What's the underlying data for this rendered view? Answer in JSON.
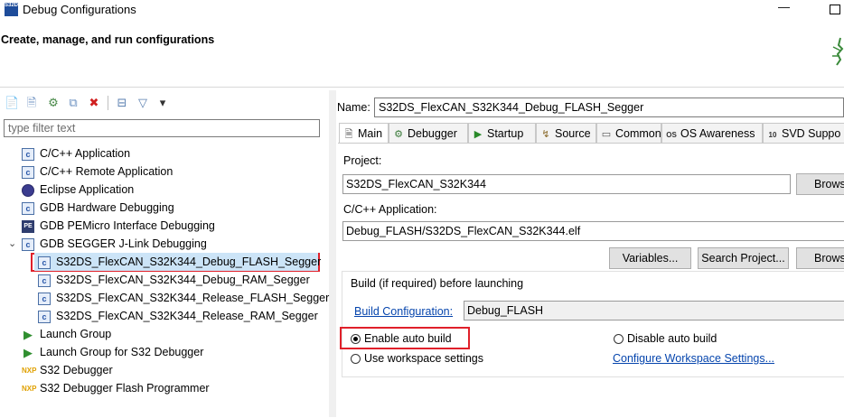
{
  "window": {
    "title": "Debug Configurations",
    "app_icon_text": "S32DS",
    "minimize_glyph": "—"
  },
  "header": {
    "title": "Create, manage, and run configurations"
  },
  "left": {
    "toolbar": [
      {
        "name": "new-configuration-icon",
        "glyph": "📄"
      },
      {
        "name": "new-prototype-icon",
        "glyph": "🗎"
      },
      {
        "name": "export-icon",
        "glyph": "⚙"
      },
      {
        "name": "duplicate-icon",
        "glyph": "⧉"
      },
      {
        "name": "delete-icon",
        "glyph": "✖"
      },
      {
        "name": "collapse-all-icon",
        "glyph": "⊟"
      },
      {
        "name": "filter-icon",
        "glyph": "▽"
      },
      {
        "name": "view-menu-icon",
        "glyph": "▾"
      }
    ],
    "filter_placeholder": "type filter text",
    "tree": [
      {
        "label": "C/C++ Application",
        "icon": "c",
        "indent": 0
      },
      {
        "label": "C/C++ Remote Application",
        "icon": "c",
        "indent": 0
      },
      {
        "label": "Eclipse Application",
        "icon": "eclipse",
        "indent": 0
      },
      {
        "label": "GDB Hardware Debugging",
        "icon": "c",
        "indent": 0
      },
      {
        "label": "GDB PEMicro Interface Debugging",
        "icon": "pe",
        "indent": 0
      },
      {
        "label": "GDB SEGGER J-Link Debugging",
        "icon": "c",
        "indent": 0,
        "expanded": true
      },
      {
        "label": "S32DS_FlexCAN_S32K344_Debug_FLASH_Segger",
        "icon": "c",
        "indent": 1,
        "selected": true
      },
      {
        "label": "S32DS_FlexCAN_S32K344_Debug_RAM_Segger",
        "icon": "c",
        "indent": 1
      },
      {
        "label": "S32DS_FlexCAN_S32K344_Release_FLASH_Segger",
        "icon": "c",
        "indent": 1
      },
      {
        "label": "S32DS_FlexCAN_S32K344_Release_RAM_Segger",
        "icon": "c",
        "indent": 1
      },
      {
        "label": "Launch Group",
        "icon": "launch",
        "indent": 0
      },
      {
        "label": "Launch Group for S32 Debugger",
        "icon": "launch",
        "indent": 0
      },
      {
        "label": "S32 Debugger",
        "icon": "nxp",
        "indent": 0
      },
      {
        "label": "S32 Debugger Flash Programmer",
        "icon": "nxp",
        "indent": 0
      }
    ]
  },
  "right": {
    "name_label": "Name:",
    "name_value": "S32DS_FlexCAN_S32K344_Debug_FLASH_Segger",
    "tabs": [
      {
        "label": "Main",
        "glyph": "🗎",
        "active": true
      },
      {
        "label": "Debugger",
        "glyph": "⚙"
      },
      {
        "label": "Startup",
        "glyph": "▶"
      },
      {
        "label": "Source",
        "glyph": "↯"
      },
      {
        "label": "Common",
        "glyph": "▭"
      },
      {
        "label": "OS Awareness",
        "glyph": "OS"
      },
      {
        "label": "SVD Suppo",
        "glyph": "10"
      }
    ],
    "main": {
      "project_label": "Project:",
      "project_value": "S32DS_FlexCAN_S32K344",
      "browse1": "Brows",
      "app_label": "C/C++ Application:",
      "app_value": "Debug_FLASH/S32DS_FlexCAN_S32K344.elf",
      "variables_btn": "Variables...",
      "search_btn": "Search Project...",
      "browse2": "Brows",
      "build_group_label": "Build (if required) before launching",
      "build_config_link": "Build Configuration:",
      "build_config_value": "Debug_FLASH",
      "enable_auto_build": "Enable auto build",
      "disable_auto_build": "Disable auto build",
      "use_workspace": "Use workspace settings",
      "configure_workspace_link": "Configure Workspace Settings..."
    }
  }
}
